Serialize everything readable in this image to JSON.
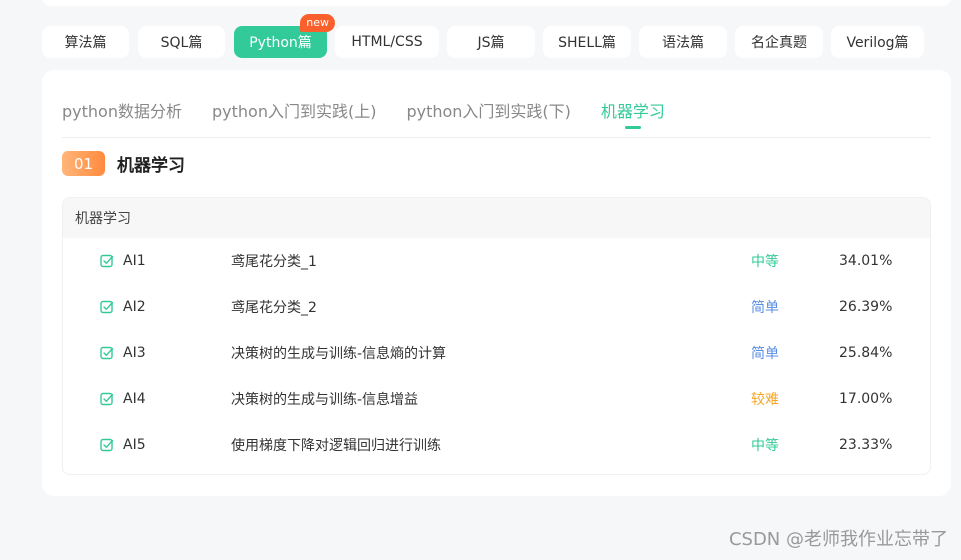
{
  "categories": [
    {
      "label": "算法篇"
    },
    {
      "label": "SQL篇"
    },
    {
      "label": "Python篇",
      "badge": "new"
    },
    {
      "label": "HTML/CSS"
    },
    {
      "label": "JS篇"
    },
    {
      "label": "SHELL篇"
    },
    {
      "label": "语法篇"
    },
    {
      "label": "名企真题"
    },
    {
      "label": "Verilog篇"
    }
  ],
  "subtabs": [
    {
      "label": "python数据分析"
    },
    {
      "label": "python入门到实践(上)"
    },
    {
      "label": "python入门到实践(下)"
    },
    {
      "label": "机器学习"
    }
  ],
  "section": {
    "number": "01",
    "title": "机器学习"
  },
  "problem_box": {
    "header": "机器学习",
    "rows": [
      {
        "id": "AI1",
        "name": "鸢尾花分类_1",
        "difficulty": "中等",
        "pass_rate": "34.01%"
      },
      {
        "id": "AI2",
        "name": "鸢尾花分类_2",
        "difficulty": "简单",
        "pass_rate": "26.39%"
      },
      {
        "id": "AI3",
        "name": "决策树的生成与训练-信息熵的计算",
        "difficulty": "简单",
        "pass_rate": "25.84%"
      },
      {
        "id": "AI4",
        "name": "决策树的生成与训练-信息增益",
        "difficulty": "较难",
        "pass_rate": "17.00%"
      },
      {
        "id": "AI5",
        "name": "使用梯度下降对逻辑回归进行训练",
        "difficulty": "中等",
        "pass_rate": "23.33%"
      }
    ]
  },
  "colors": {
    "accent": "#32ca99",
    "easy": "#5a8ee6",
    "medium": "#32ca99",
    "hard": "#f5a623",
    "badge": "#fa5f2c"
  },
  "watermark": "CSDN @老师我作业忘带了"
}
